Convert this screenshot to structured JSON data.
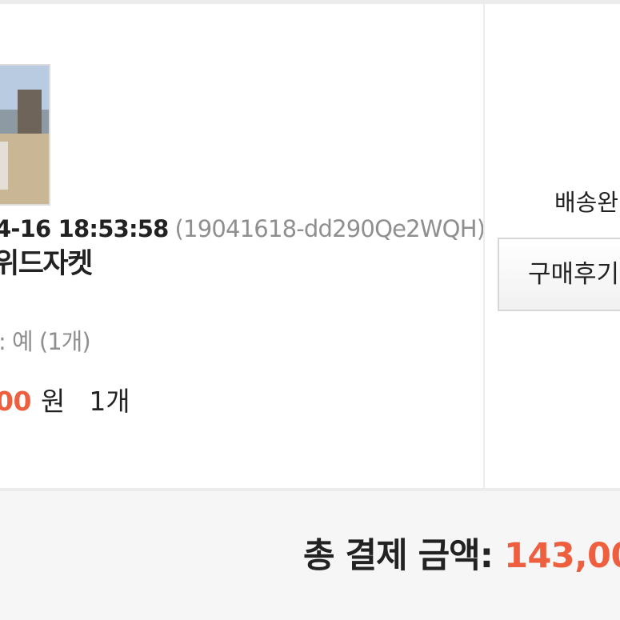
{
  "order": {
    "date": "4-16 18:53:58",
    "order_id": "(19041618-dd290Qe2WQH)",
    "product_name": "위드자켓",
    "option": ": 예 (1개)",
    "price": "00",
    "price_unit": "원",
    "quantity": "1개",
    "delivery_status": "배송완",
    "review_button_label": "구매후기"
  },
  "summary": {
    "total_label": "총 결제 금액:",
    "total_value": "143,00"
  },
  "colors": {
    "accent": "#ee5f3f",
    "text": "#222222",
    "muted": "#8f8f8f",
    "background": "#f6f6f6"
  }
}
